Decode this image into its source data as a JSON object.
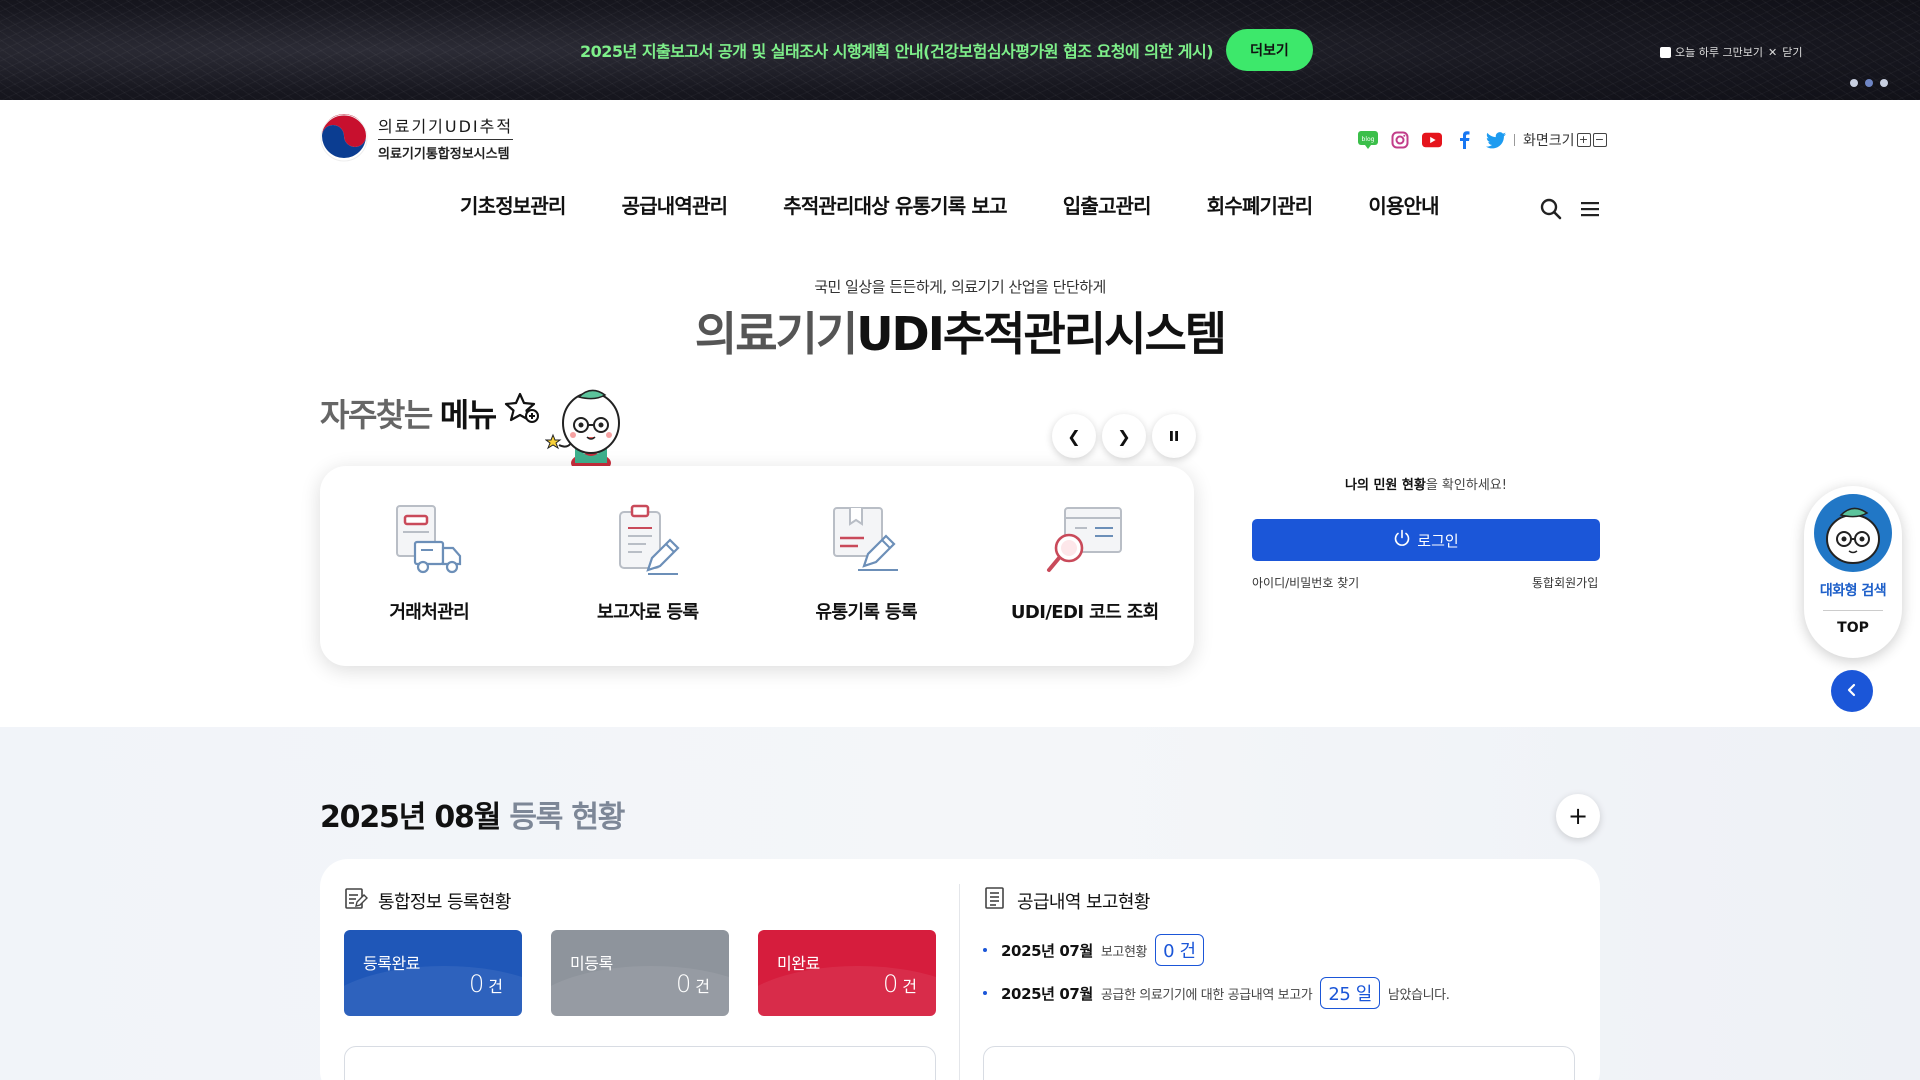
{
  "banner": {
    "text": "2025년 지출보고서 공개 및 실태조사 시행계획 안내(건강보험심사평가원 협조 요청에 의한 게시)",
    "more_label": "더보기",
    "today_label": "오늘 하루 그만보기",
    "close_label": "닫기",
    "slides": 3
  },
  "header": {
    "logo_line1": "의료기기UDI추적",
    "logo_line2": "의료기기통합정보시스템",
    "font_size_label": "화면크기",
    "social": [
      "blog-icon",
      "instagram-icon",
      "youtube-icon",
      "facebook-icon",
      "twitter-icon"
    ],
    "nav": [
      "기초정보관리",
      "공급내역관리",
      "추적관리대상 유통기록 보고",
      "입출고관리",
      "회수폐기관리",
      "이용안내"
    ]
  },
  "hero": {
    "subtitle": "국민 일상을 든든하게, 의료기기 산업을 단단하게",
    "title_light": "의료기기",
    "title_bold": "UDI추적관리시스템"
  },
  "favorites": {
    "title_light": "자주찾는",
    "title_bold": "메뉴",
    "items": [
      {
        "label": "거래처관리",
        "icon": "supplier-truck-icon"
      },
      {
        "label": "보고자료 등록",
        "icon": "report-clipboard-icon"
      },
      {
        "label": "유통기록 등록",
        "icon": "distribution-box-icon"
      },
      {
        "label": "UDI/EDI 코드 조회",
        "icon": "code-search-icon"
      }
    ]
  },
  "login": {
    "message_bold": "나의 민원 현황",
    "message_rest": "을 확인하세요!",
    "button_label": "로그인",
    "find_label": "아이디/비밀번호 찾기",
    "join_label": "통합회원가입"
  },
  "floating": {
    "chat_label": "대화형 검색",
    "top_label": "TOP"
  },
  "status": {
    "title_dark": "2025년 08월",
    "title_gray": "등록 현황",
    "left_panel": {
      "title": "통합정보 등록현황",
      "boxes": [
        {
          "label": "등록완료",
          "value": "0",
          "unit": "건",
          "color": "#1f57b8"
        },
        {
          "label": "미등록",
          "value": "0",
          "unit": "건",
          "color": "#8e949c"
        },
        {
          "label": "미완료",
          "value": "0",
          "unit": "건",
          "color": "#d61d3d"
        }
      ]
    },
    "right_panel": {
      "title": "공급내역 보고현황",
      "row1": {
        "ym": "2025년 07월",
        "label": "보고현황",
        "value": "0 건"
      },
      "row2": {
        "ym": "2025년 07월",
        "label": "공급한 의료기기에 대한 공급내역 보고가",
        "value": "25 일",
        "suffix": "남았습니다."
      }
    }
  },
  "colors": {
    "accent": "#1b56d8",
    "banner_text": "#7ef08a",
    "banner_button": "#3de86b"
  }
}
